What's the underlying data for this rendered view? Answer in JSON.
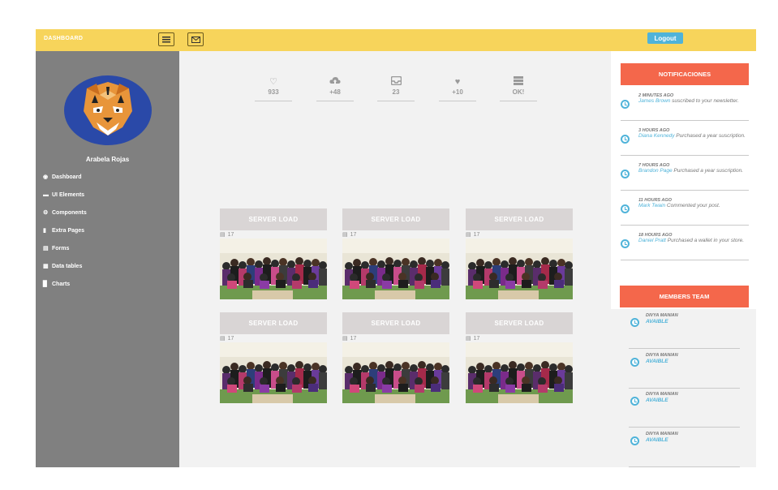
{
  "topbar": {
    "brand": "DASHBOARD",
    "logout_label": "Logout",
    "icons": [
      "menu-icon",
      "mail-icon"
    ]
  },
  "sidebar": {
    "user_name": "Arabela Rojas",
    "items": [
      {
        "label": "Dashboard",
        "icon": "dashboard-icon"
      },
      {
        "label": "UI Elements",
        "icon": "elements-icon"
      },
      {
        "label": "Components",
        "icon": "gear-icon"
      },
      {
        "label": "Extra Pages",
        "icon": "file-icon"
      },
      {
        "label": "Forms",
        "icon": "forms-icon"
      },
      {
        "label": "Data tables",
        "icon": "table-icon"
      },
      {
        "label": "Charts",
        "icon": "bar-chart-icon"
      }
    ]
  },
  "stats": [
    {
      "value": "933",
      "icon": "heart-outline-icon"
    },
    {
      "value": "+48",
      "icon": "cloud-upload-icon"
    },
    {
      "value": "23",
      "icon": "inbox-icon"
    },
    {
      "value": "+10",
      "icon": "heart-icon"
    },
    {
      "value": "OK!",
      "icon": "server-icon"
    }
  ],
  "cards": [
    {
      "title": "SERVER LOAD",
      "count": "17"
    },
    {
      "title": "SERVER LOAD",
      "count": "17"
    },
    {
      "title": "SERVER LOAD",
      "count": "17"
    },
    {
      "title": "SERVER LOAD",
      "count": "17"
    },
    {
      "title": "SERVER LOAD",
      "count": "17"
    },
    {
      "title": "SERVER LOAD",
      "count": "17"
    }
  ],
  "notifications": {
    "title": "NOTIFICACIONES",
    "items": [
      {
        "time": "2 MINUTES AGO",
        "who": "James Brown",
        "text": " suscribed to your newsletter."
      },
      {
        "time": "3 HOURS AGO",
        "who": "Diana Kennedy",
        "text": " Purchased a year suscription."
      },
      {
        "time": "7 HOURS AGO",
        "who": "Brandon Page",
        "text": " Purchased a year suscription."
      },
      {
        "time": "11 HOURS AGO",
        "who": "Mark Twain",
        "text": " Commented your post."
      },
      {
        "time": "18 HOURS AGO",
        "who": "Daniel Pratt",
        "text": " Purchased a wallet in your store."
      }
    ]
  },
  "members": {
    "title": "MEMBERS TEAM",
    "items": [
      {
        "name": "DIVYA MANIAN",
        "status": "AVAIBLE"
      },
      {
        "name": "DIVYA MANIAN",
        "status": "AVAIBLE"
      },
      {
        "name": "DIVYA MANIAN",
        "status": "AVAIBLE"
      },
      {
        "name": "DIVYA MANIAN",
        "status": "AVAIBLE"
      }
    ]
  },
  "colors": {
    "topbar": "#f7d45b",
    "sidebar": "#808080",
    "accent": "#4fb3d9",
    "panel_header": "#f4674b",
    "card_header": "#d9d5d5",
    "page_bg": "#f2f2f2"
  }
}
